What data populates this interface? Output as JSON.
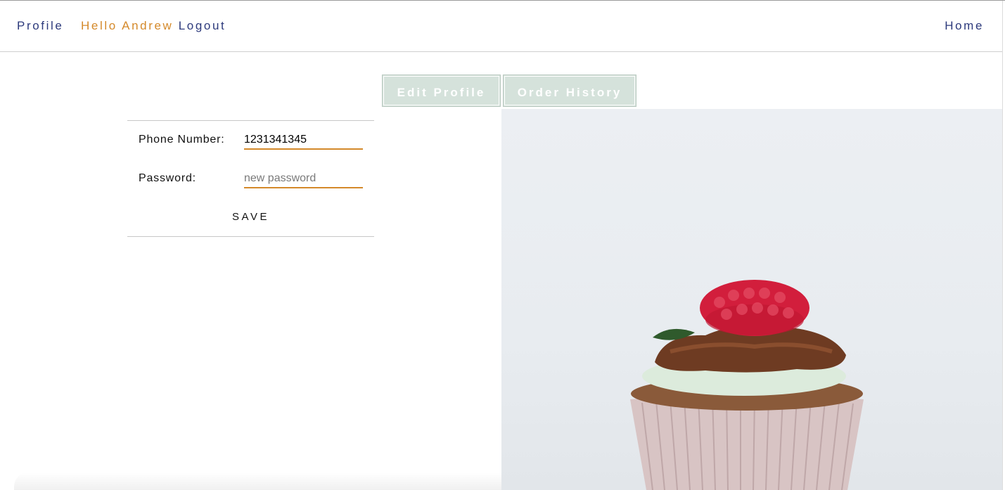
{
  "header": {
    "profile_link": "Profile",
    "greeting": "Hello Andrew",
    "logout_link": "Logout",
    "home_link": "Home"
  },
  "tabs": [
    {
      "label": "Edit Profile"
    },
    {
      "label": "Order History"
    }
  ],
  "form": {
    "phone_label": "Phone Number:",
    "phone_value": "1231341345",
    "password_label": "Password:",
    "password_placeholder": "new password",
    "save_label": "SAVE"
  },
  "colors": {
    "nav_link": "#2d3a7c",
    "greeting": "#d4892a",
    "tab_bg": "#d5e2db",
    "input_underline": "#d4892a"
  },
  "hero_image": {
    "subject": "cupcake-with-raspberry"
  }
}
